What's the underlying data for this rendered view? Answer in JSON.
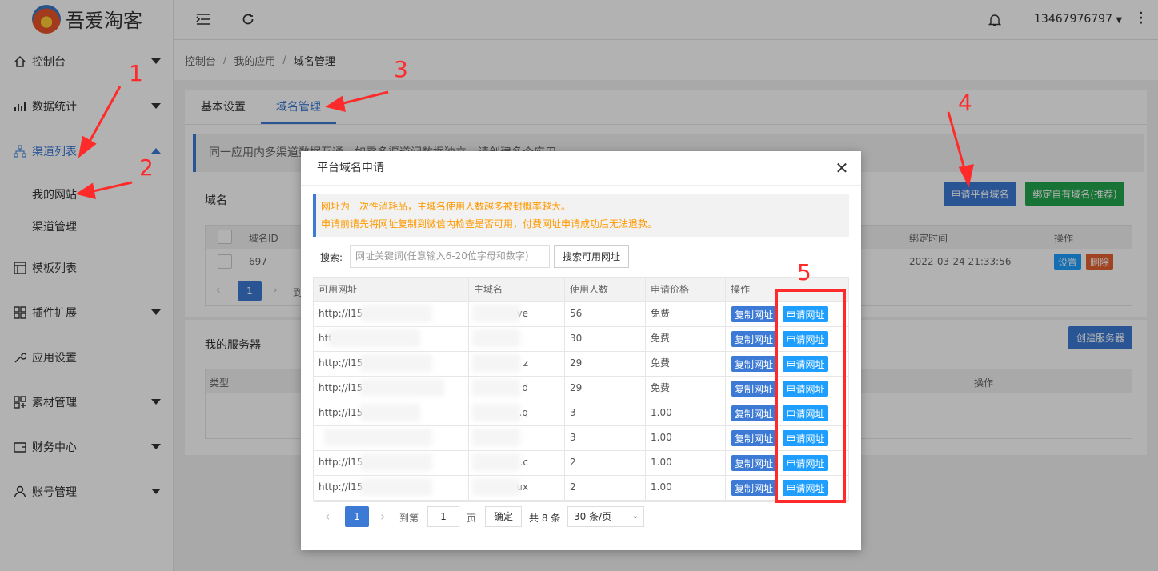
{
  "app": {
    "name": "吾爱淘客",
    "user": "13467976797"
  },
  "sidebar": {
    "items": [
      {
        "label": "控制台",
        "icon": "home-icon"
      },
      {
        "label": "数据统计",
        "icon": "bar-chart-icon"
      },
      {
        "label": "渠道列表",
        "icon": "sitemap-icon"
      },
      {
        "label": "模板列表",
        "icon": "layout-icon"
      },
      {
        "label": "插件扩展",
        "icon": "grid-icon"
      },
      {
        "label": "应用设置",
        "icon": "wrench-icon"
      },
      {
        "label": "素材管理",
        "icon": "apps-icon"
      },
      {
        "label": "财务中心",
        "icon": "wallet-icon"
      },
      {
        "label": "账号管理",
        "icon": "user-icon"
      }
    ],
    "sub": [
      "我的网站",
      "渠道管理"
    ]
  },
  "breadcrumb": [
    "控制台",
    "我的应用",
    "域名管理"
  ],
  "tabs": [
    "基本设置",
    "域名管理"
  ],
  "notice": "同一应用内多渠道数据互通，如需多渠道间数据独立，请创建多个应用",
  "domain_section": {
    "title": "域名",
    "apply_btn": "申请平台域名",
    "bind_btn": "绑定自有域名(推荐)",
    "headers": [
      "域名ID",
      "绑定时间",
      "操作"
    ],
    "row": {
      "id": "697",
      "time": "2022-03-24 21:33:56",
      "set": "设置",
      "del": "删除"
    },
    "page": "1",
    "goto": "到"
  },
  "server_section": {
    "title": "我的服务器",
    "create_btn": "创建服务器",
    "headers": [
      "类型",
      "操作"
    ]
  },
  "modal": {
    "title": "平台域名申请",
    "tips": [
      "网址为一次性消耗品，主域名使用人数越多被封概率越大。",
      "申请前请先将网址复制到微信内检查是否可用，付费网址申请成功后无法退款。"
    ],
    "search_label": "搜索:",
    "search_placeholder": "网址关键词(任意输入6-20位字母和数字)",
    "search_btn": "搜索可用网址",
    "headers": [
      "可用网址",
      "主域名",
      "使用人数",
      "申请价格",
      "操作"
    ],
    "rows": [
      {
        "url": "http://l151",
        "domain": "ive",
        "users": "56",
        "price": "免费"
      },
      {
        "url": "http",
        "domain": "",
        "users": "30",
        "price": "免费"
      },
      {
        "url": "http://l15",
        "domain": "z",
        "users": "29",
        "price": "免费"
      },
      {
        "url": "http://l151cx",
        "domain": "d",
        "users": "29",
        "price": "免费"
      },
      {
        "url": "http://l151c",
        "domain": ".q",
        "users": "3",
        "price": "1.00"
      },
      {
        "url": "",
        "domain": "",
        "users": "3",
        "price": "1.00"
      },
      {
        "url": "http://l15",
        "domain": ".c",
        "users": "2",
        "price": "1.00"
      },
      {
        "url": "http://l15",
        "domain": ".hux",
        "users": "2",
        "price": "1.00"
      }
    ],
    "copy_btn": "复制网址",
    "apply_btn": "申请网址",
    "pager": {
      "page": "1",
      "goto": "到第",
      "input": "1",
      "page_unit": "页",
      "confirm": "确定",
      "total": "共 8 条",
      "size": "30 条/页"
    }
  },
  "annotations": [
    "1",
    "2",
    "3",
    "4",
    "5"
  ]
}
